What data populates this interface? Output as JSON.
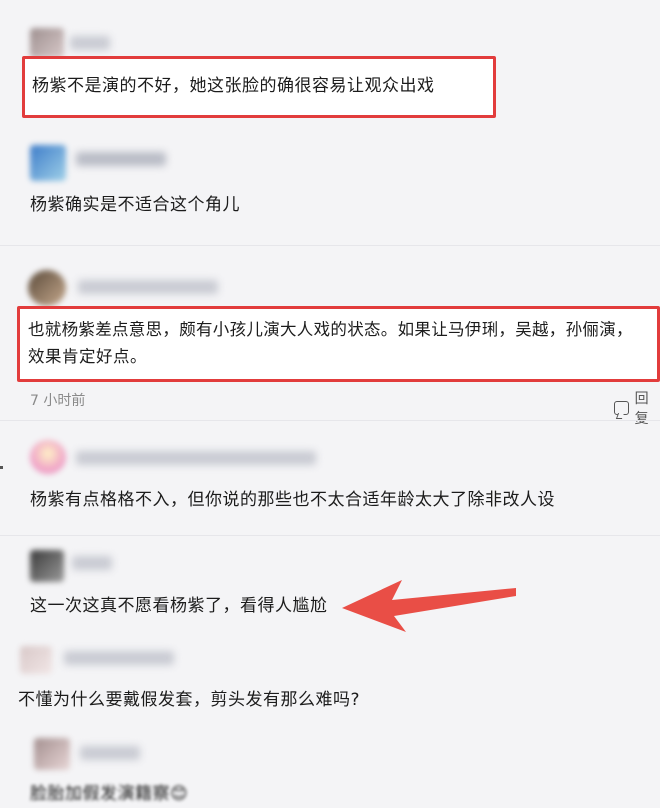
{
  "comments": [
    {
      "text": "杨紫不是演的不好，她这张脸的确很容易让观众出戏"
    },
    {
      "text": "杨紫确实是不适合这个角儿"
    },
    {
      "text_line1": "也就杨紫差点意思，颇有小孩儿演大人戏的状态。如果让马伊琍，吴越，孙俪演，",
      "text_line2": "效果肯定好点。",
      "time": "7 小时前",
      "reply_label": "回复"
    },
    {
      "text": "杨紫有点格格不入，但你说的那些也不太合适年龄太大了除非改人设"
    },
    {
      "text": "这一次这真不愿看杨紫了，看得人尴尬"
    },
    {
      "text": "不懂为什么要戴假发套，剪头发有那么难吗?"
    },
    {
      "text": "脸胎加假发演籍察😊"
    }
  ],
  "colors": {
    "highlight_border": "#e23c3c",
    "arrow": "#e8453c"
  }
}
